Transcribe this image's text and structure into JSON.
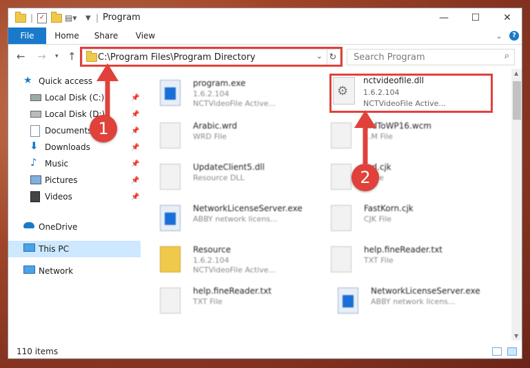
{
  "window": {
    "title": "Program",
    "controls": [
      "—",
      "☐",
      "✕"
    ]
  },
  "ribbon": {
    "tabs": [
      "File",
      "Home",
      "Share",
      "View"
    ]
  },
  "address": {
    "path": "C:\\Program Files\\Program Directory",
    "search_placeholder": "Search Program"
  },
  "nav": {
    "items": [
      {
        "label": "Quick access",
        "icon": "star-icon"
      },
      {
        "label": "Local Disk (C:)",
        "icon": "drive-icon"
      },
      {
        "label": "Local Disk (D:)",
        "icon": "drive-icon"
      },
      {
        "label": "Documents",
        "icon": "documents-icon"
      },
      {
        "label": "Downloads",
        "icon": "downloads-icon"
      },
      {
        "label": "Music",
        "icon": "music-icon"
      },
      {
        "label": "Pictures",
        "icon": "pictures-icon"
      },
      {
        "label": "Videos",
        "icon": "videos-icon"
      },
      {
        "label": "OneDrive",
        "icon": "onedrive-icon"
      },
      {
        "label": "This PC",
        "icon": "this-pc-icon"
      },
      {
        "label": "Network",
        "icon": "network-icon"
      }
    ]
  },
  "files": [
    {
      "name": "program.exe",
      "line2": "1.6.2.104",
      "line3": "NCTVideoFile Active...",
      "kind": "exe"
    },
    {
      "name": "nctvideofile.dll",
      "line2": "1.6.2.104",
      "line3": "NCTVideoFile Active...",
      "kind": "dll"
    },
    {
      "name": "Arabic.wrd",
      "line2": "WRD File",
      "line3": "",
      "kind": "doc"
    },
    {
      "name": "...dToWP16.wcm",
      "line2": "...M File",
      "line3": "",
      "kind": "doc"
    },
    {
      "name": "UpdateClient5.dll",
      "line2": "Resource DLL",
      "line3": "",
      "kind": "dll"
    },
    {
      "name": "...d.cjk",
      "line2": "...File",
      "line3": "",
      "kind": "doc"
    },
    {
      "name": "NetworkLicenseServer.exe",
      "line2": "ABBY network licens...",
      "line3": "",
      "kind": "exe"
    },
    {
      "name": "FastKorn.cjk",
      "line2": "CJK File",
      "line3": "",
      "kind": "doc"
    },
    {
      "name": "Resource",
      "line2": "1.6.2.104",
      "line3": "NCTVideoFile Active...",
      "kind": "folder"
    },
    {
      "name": "help.fineReader.txt",
      "line2": "TXT File",
      "line3": "",
      "kind": "doc"
    },
    {
      "name": "help.fineReader.txt",
      "line2": "TXT File",
      "line3": "",
      "kind": "doc"
    },
    {
      "name": "NetworkLicenseServer.exe",
      "line2": "ABBY network licens...",
      "line3": "",
      "kind": "exe"
    }
  ],
  "status": {
    "item_count": "110 items"
  },
  "annotations": {
    "step1": "1",
    "step2": "2",
    "color": "#e0413a"
  }
}
